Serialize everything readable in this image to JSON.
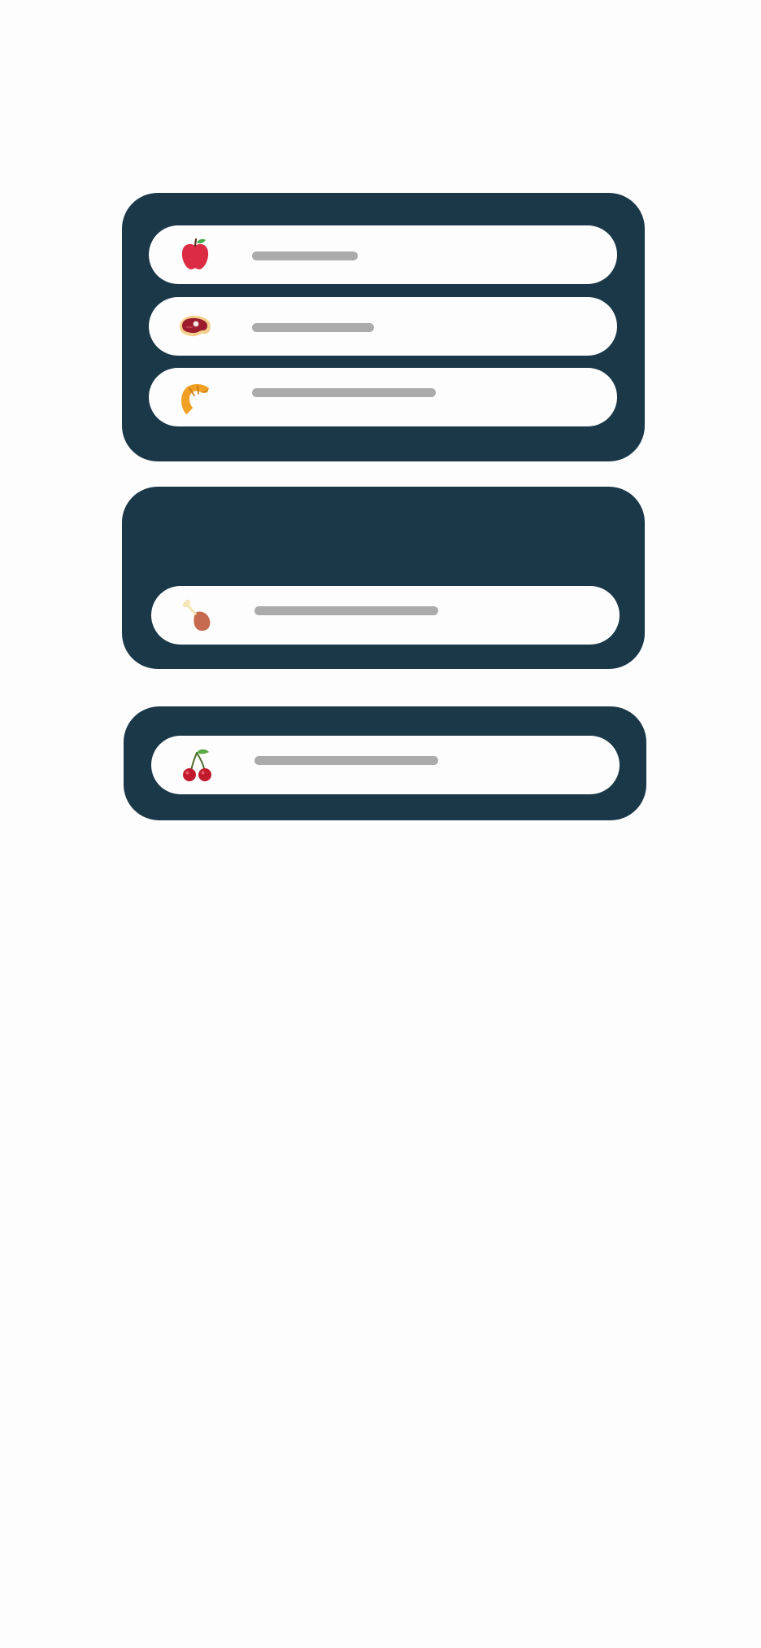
{
  "colors": {
    "page_background": "#fdfdfd",
    "card_background": "#1b3849",
    "row_background": "#fdfdfd",
    "placeholder_bar": "#ababab"
  },
  "cards": [
    {
      "items": [
        {
          "icon": "apple-icon",
          "placeholder_fill": 0.5
        },
        {
          "icon": "steak-icon",
          "placeholder_fill": 0.58
        },
        {
          "icon": "croissant-icon",
          "placeholder_fill": 0.88
        }
      ]
    },
    {
      "items": [
        {
          "icon": "chicken-leg-icon",
          "placeholder_fill": 0.88
        }
      ]
    },
    {
      "items": [
        {
          "icon": "cherry-icon",
          "placeholder_fill": 0.88
        }
      ]
    }
  ]
}
